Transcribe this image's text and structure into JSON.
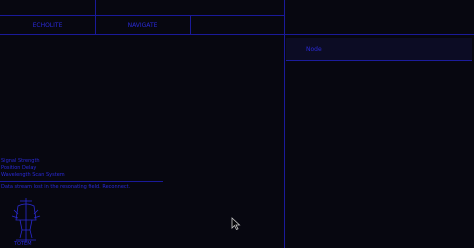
{
  "toolbar": {
    "button_left": "ECHOLITE",
    "button_right": "NAVIGATE"
  },
  "side_panel": {
    "header_label": "Node"
  },
  "info": {
    "line1": "Signal Strength",
    "line2": "Position Delay",
    "line3": "Wavelength Scan System",
    "warning": "Data stream lost in the resonating field. Reconnect."
  },
  "figure_label": "TOTEM",
  "colors": {
    "background": "#070710",
    "accent": "#1a1ac8",
    "line": "#1a1a9a"
  }
}
